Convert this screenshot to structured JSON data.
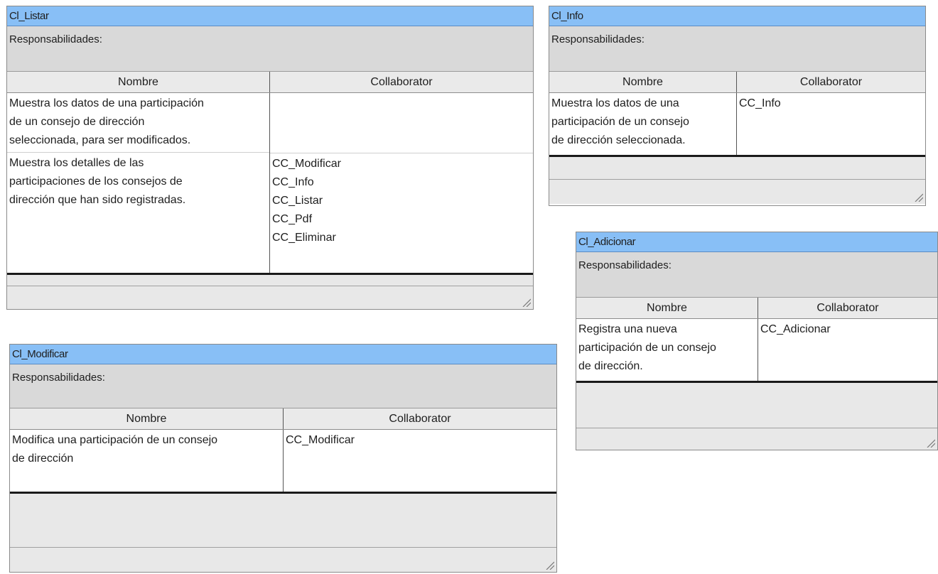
{
  "cards": [
    {
      "title": "Cl_Listar",
      "responsibilities_label": "Responsabilidades:",
      "col_name": "Nombre",
      "col_collab": "Collaborator",
      "rows": [
        {
          "lines": [
            "Muestra los datos de una participación",
            "de un consejo de dirección",
            "seleccionada, para ser modificados."
          ],
          "collaborators": []
        },
        {
          "lines": [
            "Muestra los detalles de las",
            "participaciones de los consejos de",
            "dirección que han sido registradas."
          ],
          "collaborators": [
            "CC_Modificar",
            "CC_Info",
            "CC_Listar",
            "CC_Pdf",
            "CC_Eliminar"
          ]
        }
      ]
    },
    {
      "title": "Cl_Info",
      "responsibilities_label": "Responsabilidades:",
      "col_name": "Nombre",
      "col_collab": "Collaborator",
      "rows": [
        {
          "lines": [
            "Muestra los datos de una",
            "participación de un consejo",
            "de dirección seleccionada."
          ],
          "collaborators": [
            "CC_Info"
          ]
        }
      ]
    },
    {
      "title": "Cl_Adicionar",
      "responsibilities_label": "Responsabilidades:",
      "col_name": "Nombre",
      "col_collab": "Collaborator",
      "rows": [
        {
          "lines": [
            "Registra una nueva",
            "participación de un consejo",
            "de dirección."
          ],
          "collaborators": [
            "CC_Adicionar"
          ]
        }
      ]
    },
    {
      "title": "Cl_Modificar",
      "responsibilities_label": "Responsabilidades:",
      "col_name": "Nombre",
      "col_collab": "Collaborator",
      "rows": [
        {
          "lines": [
            "Modifica una participación de un consejo",
            "de dirección"
          ],
          "collaborators": [
            "CC_Modificar"
          ]
        }
      ]
    }
  ],
  "colors": {
    "title_bar": "#88bff6",
    "responsibilities_bg": "#d9d9d9",
    "header_bg": "#eaeaea",
    "footer_bg": "#e8e8e8"
  }
}
